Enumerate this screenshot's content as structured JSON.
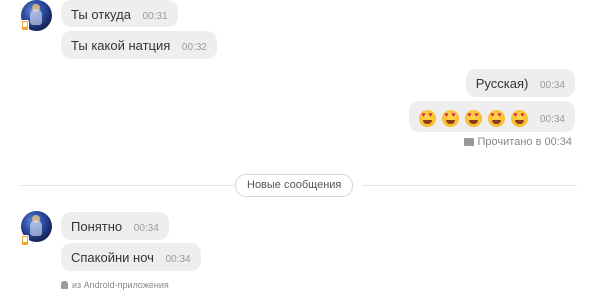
{
  "messages_top": [
    {
      "text": "Ты откуда",
      "time": "00:31"
    },
    {
      "text": "Ты какой натция",
      "time": "00:32"
    }
  ],
  "messages_mine": [
    {
      "text": "Русская)",
      "time": "00:34"
    },
    {
      "emojis": [
        "heart-eyes-emoji",
        "heart-eyes-emoji",
        "heart-eyes-emoji",
        "heart-eyes-emoji",
        "heart-eyes-emoji"
      ],
      "time": "00:34"
    }
  ],
  "read_status": "Прочитано в 00:34",
  "divider": {
    "label": "Новые сообщения"
  },
  "messages_bottom": [
    {
      "text": "Понятно",
      "time": "00:34"
    },
    {
      "text": "Спакойни ноч",
      "time": "00:34"
    }
  ],
  "platform_note": "из Android-приложения",
  "colors": {
    "bubble": "#eeeeee",
    "badge": "#f0a531",
    "text": "#333333",
    "muted": "#9a9a9a"
  },
  "icons": {
    "read": "envelope-open-icon",
    "platform": "android-icon",
    "online": "mobile-online-icon"
  }
}
